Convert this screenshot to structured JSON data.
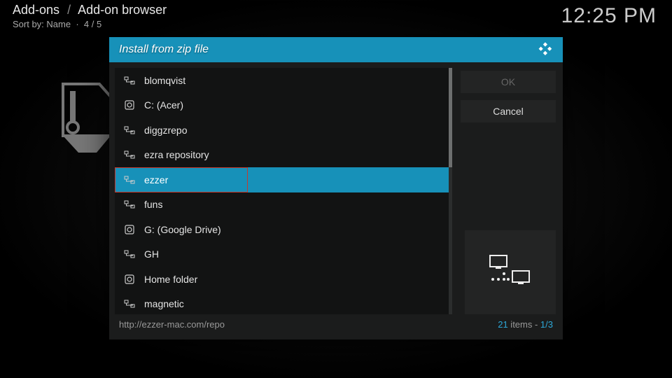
{
  "breadcrumb": {
    "a": "Add-ons",
    "b": "Add-on browser"
  },
  "sort": {
    "label": "Sort by: Name",
    "sep": "·",
    "count": "4 / 5"
  },
  "clock": "12:25 PM",
  "dialog": {
    "title": "Install from zip file",
    "items": [
      {
        "label": "blomqvist",
        "kind": "net"
      },
      {
        "label": "C: (Acer)",
        "kind": "drive"
      },
      {
        "label": "diggzrepo",
        "kind": "net"
      },
      {
        "label": "ezra repository",
        "kind": "net"
      },
      {
        "label": "ezzer",
        "kind": "net",
        "selected": true
      },
      {
        "label": "funs",
        "kind": "net"
      },
      {
        "label": "G: (Google Drive)",
        "kind": "drive"
      },
      {
        "label": "GH",
        "kind": "net"
      },
      {
        "label": "Home folder",
        "kind": "drive"
      },
      {
        "label": "magnetic",
        "kind": "net"
      }
    ],
    "ok": "OK",
    "cancel": "Cancel",
    "path": "http://ezzer-mac.com/repo",
    "count_num": "21",
    "count_txt": " items - ",
    "page": "1/3"
  }
}
